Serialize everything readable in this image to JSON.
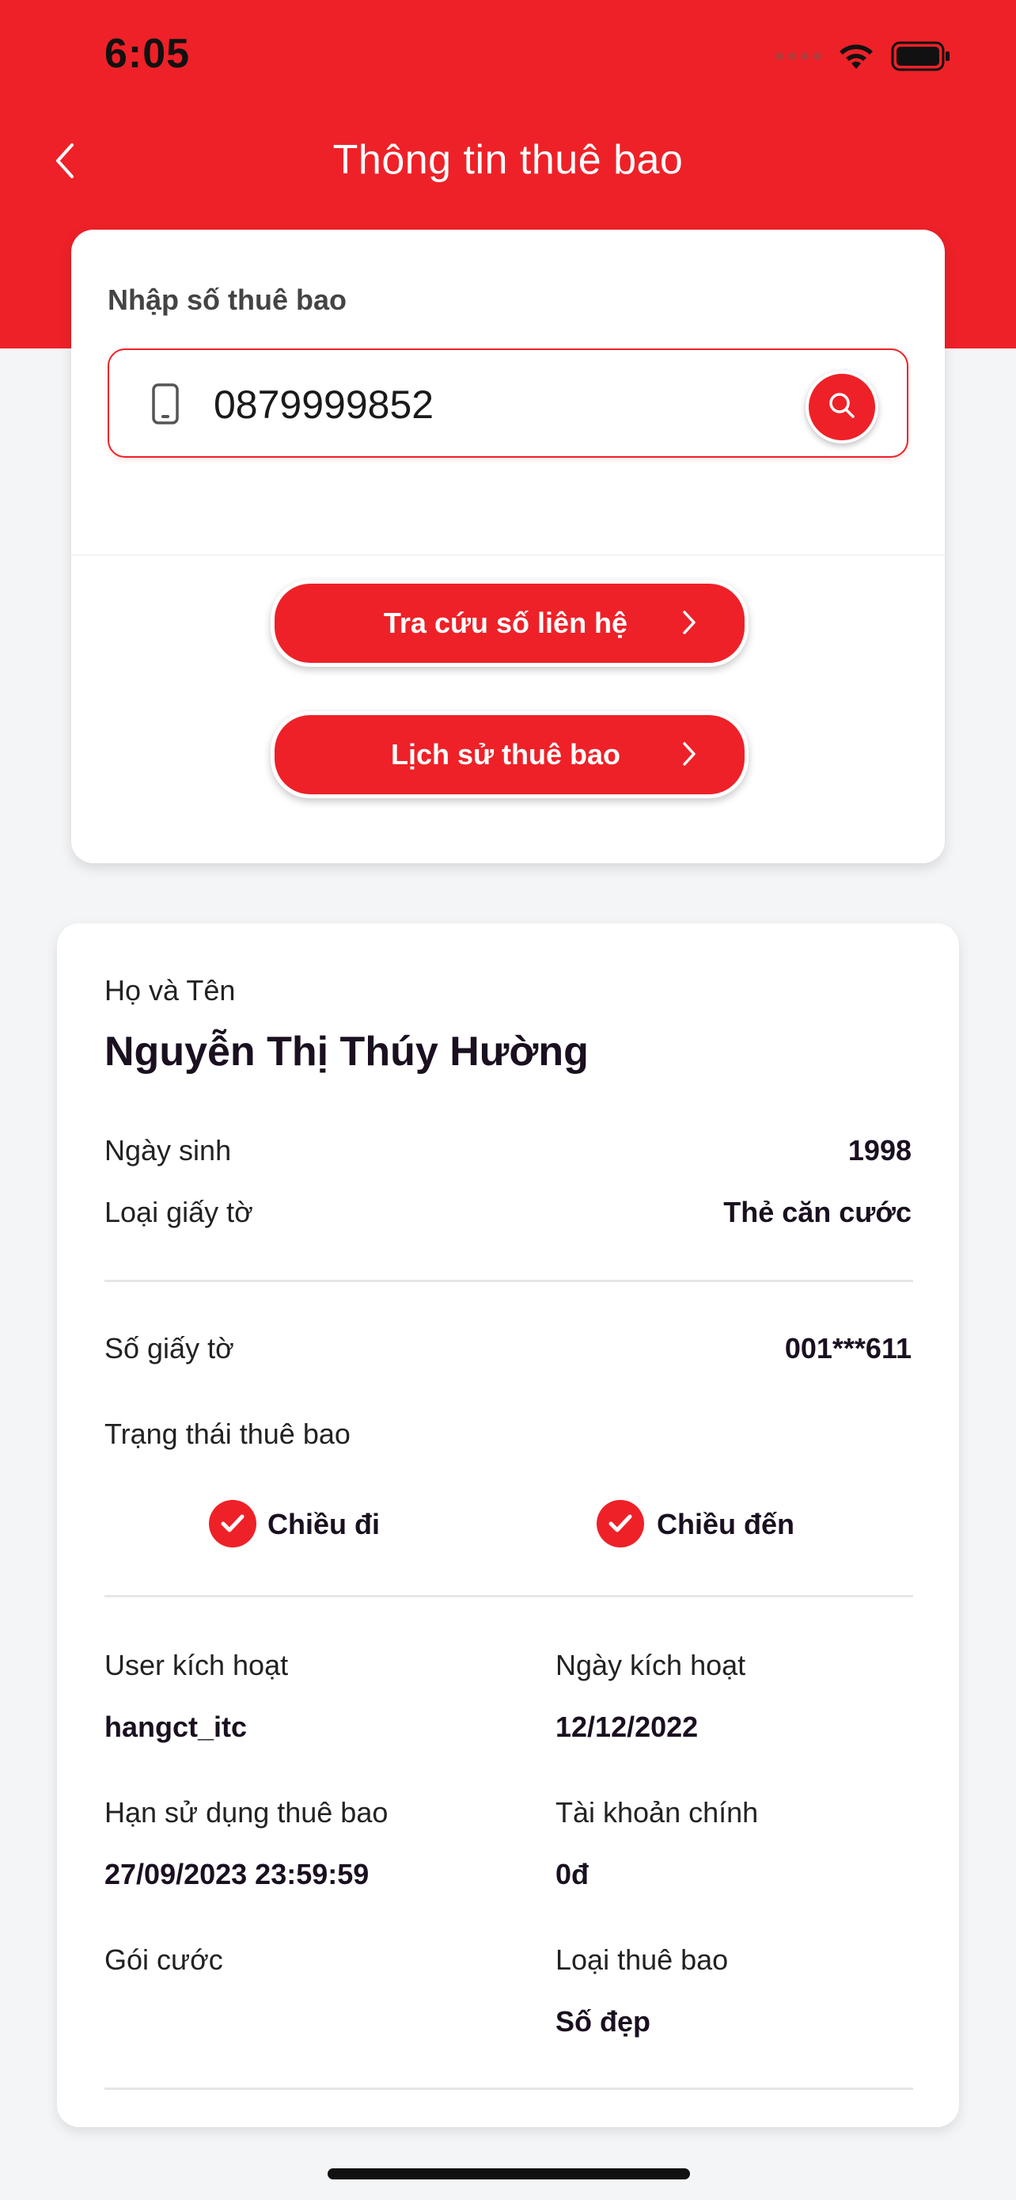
{
  "status_bar": {
    "time": "6:05"
  },
  "header": {
    "title": "Thông tin thuê bao",
    "back_icon": "chevron-left-icon"
  },
  "search": {
    "label": "Nhập số thuê bao",
    "value": "0879999852",
    "phone_icon": "phone-icon",
    "search_icon": "search-icon"
  },
  "actions": {
    "lookup_contact": "Tra cứu số liên hệ",
    "subscriber_history": "Lịch sử thuê bao"
  },
  "subscriber": {
    "name_label": "Họ và Tên",
    "name": "Nguyễn Thị Thúy Hường",
    "dob_label": "Ngày sinh",
    "dob": "1998",
    "doc_type_label": "Loại giấy tờ",
    "doc_type": "Thẻ căn cước",
    "doc_number_label": "Số giấy tờ",
    "doc_number": "001***611",
    "status_label": "Trạng thái thuê bao",
    "outgoing": "Chiều đi",
    "incoming": "Chiều đến",
    "activation_user_label": "User kích hoạt",
    "activation_user": "hangct_itc",
    "activation_date_label": "Ngày kích hoạt",
    "activation_date": "12/12/2022",
    "expiry_label": "Hạn sử dụng thuê bao",
    "expiry": "27/09/2023 23:59:59",
    "main_account_label": "Tài khoản chính",
    "main_account": "0đ",
    "package_label": "Gói cước",
    "package": "",
    "sub_type_label": "Loại thuê bao",
    "sub_type": "Số đẹp"
  },
  "colors": {
    "brand_red": "#ee2128",
    "background": "#f4f5f7"
  }
}
